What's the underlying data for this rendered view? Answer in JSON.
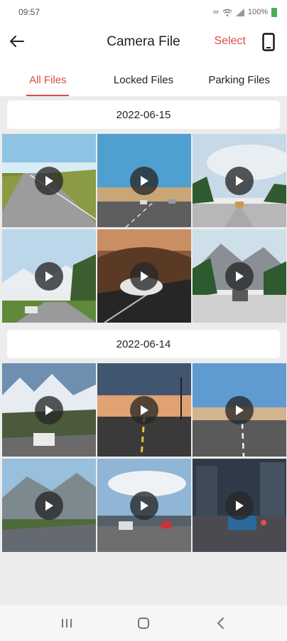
{
  "status": {
    "time": "09:57",
    "battery": "100%"
  },
  "header": {
    "title": "Camera File",
    "select_label": "Select"
  },
  "tabs": [
    {
      "label": "All Files",
      "active": true
    },
    {
      "label": "Locked Files",
      "active": false
    },
    {
      "label": "Parking Files",
      "active": false
    }
  ],
  "groups": [
    {
      "date": "2022-06-15"
    },
    {
      "date": "2022-06-14"
    }
  ],
  "colors": {
    "accent": "#e04a4a",
    "background": "#ececec"
  },
  "icons": {
    "back": "arrow-left-icon",
    "device": "phone-icon",
    "play": "play-icon",
    "nav": [
      "recents-icon",
      "home-icon",
      "back-chevron-icon"
    ]
  }
}
